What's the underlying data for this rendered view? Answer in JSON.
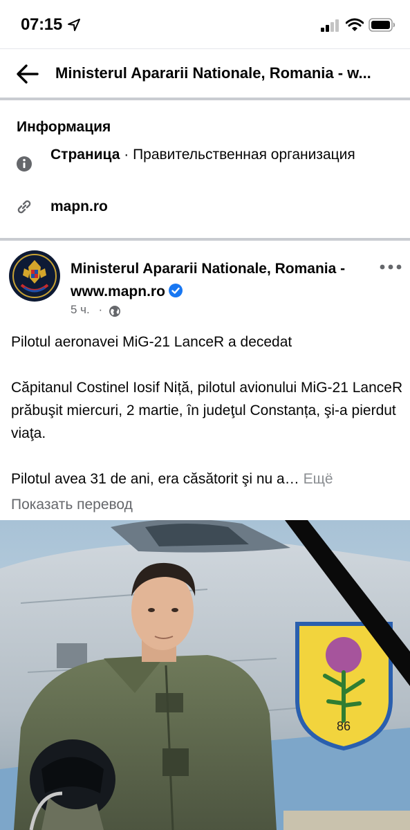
{
  "status_bar": {
    "time": "07:15"
  },
  "header": {
    "title": "Ministerul Apararii Nationale, Romania - w..."
  },
  "info": {
    "heading": "Информация",
    "category_type": "Страница",
    "category_sep": " · ",
    "category_value": "Правительственная организация",
    "website": "mapn.ro"
  },
  "post": {
    "author": "Ministerul Apararii Nationale, Romania - www.mapn.ro",
    "time": "5 ч.",
    "meta_sep": "·",
    "paragraphs": [
      "Pilotul aeronavei MiG-21 LanceR a decedat",
      "Căpitanul Costinel Iosif Niță, pilotul avionului MiG-21 LanceR prăbuşit miercuri, 2 martie, în judeţul Constanța, şi-a pierdut viaţa.",
      "Pilotul avea 31 de ani, era căsătorit şi nu a…"
    ],
    "see_more": "Ещё",
    "translate": "Показать перевод",
    "photo": {
      "badge_number": "86"
    }
  },
  "colors": {
    "accent": "#1877f2",
    "secondary_text": "#65676b",
    "divider": "#c9ccd1"
  }
}
